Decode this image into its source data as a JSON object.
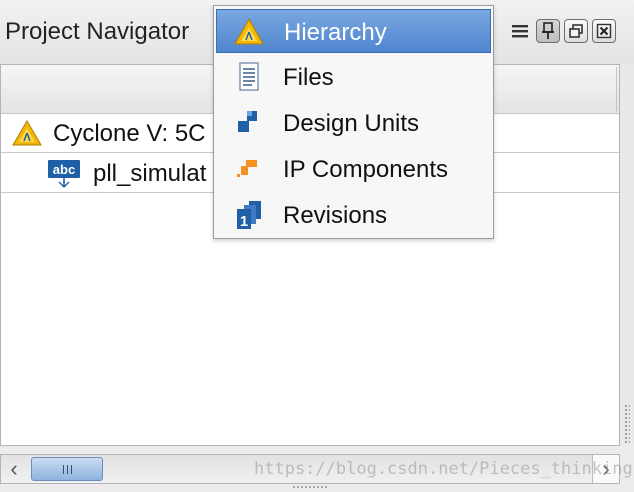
{
  "panel": {
    "title": "Project Navigator",
    "toolbar_icons": [
      "menu-lines-icon",
      "pin-icon",
      "restore-icon",
      "close-icon"
    ]
  },
  "tree": {
    "rows": [
      {
        "label": "Cyclone V: 5C",
        "icon": "quartus-triangle-icon"
      },
      {
        "label": "pll_simulat",
        "icon": "abc-entity-icon"
      }
    ]
  },
  "menu": {
    "items": [
      {
        "label": "Hierarchy",
        "icon": "hierarchy-triangle-icon",
        "selected": true
      },
      {
        "label": "Files",
        "icon": "file-document-icon",
        "selected": false
      },
      {
        "label": "Design Units",
        "icon": "design-units-icon",
        "selected": false
      },
      {
        "label": "IP Components",
        "icon": "ip-components-icon",
        "selected": false
      },
      {
        "label": "Revisions",
        "icon": "revisions-icon",
        "selected": false
      }
    ]
  },
  "scrollbar": {
    "left_arrow": "‹",
    "right_arrow": "›"
  },
  "watermark": "https://blog.csdn.net/Pieces_thinking",
  "colors": {
    "selection": "#5b8fd4",
    "quartus_yellow": "#f2b705",
    "quartus_blue": "#1f5fa6",
    "ip_orange": "#f39221"
  }
}
